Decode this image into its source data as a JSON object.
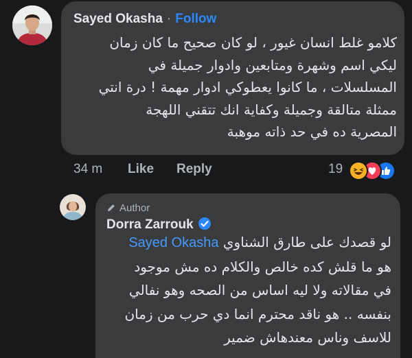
{
  "comment": {
    "author": "Sayed Okasha",
    "follow_label": "Follow",
    "separator": "·",
    "lines": [
      "كلامو غلط انسان غيور ، لو كان صحيح ما كان زمان",
      "ليكي اسم وشهرة ومتابعين وادوار جميلة في",
      "المسلسلات ، ما كانوا يعطوكي ادوار مهمة ! درة انتي",
      "ممثلة متالقة وجميلة وكفاية انك تتقني اللهجة",
      "المصرية ده في حد ذاته موهبة"
    ],
    "time": "34 m",
    "like_label": "Like",
    "reply_label": "Reply",
    "reaction_count": "19",
    "reactions": [
      "haha-icon",
      "love-icon",
      "like-icon"
    ]
  },
  "reply": {
    "badge": "Author",
    "author": "Dorra Zarrouk",
    "verified": true,
    "mention": "Sayed Okasha",
    "first_line_text": "لو قصدك على طارق الشناوي",
    "lines": [
      "هو ما قلش كده خالص والكلام ده مش موجود",
      "في مقالاته ولا ليه اساس من الصحه وهو نفالي",
      "بنفسه .. هو ناقد محترم انما دي حرب من زمان",
      "للاسف وناس معندهاش ضمير"
    ]
  },
  "colors": {
    "background": "#18191a",
    "bubble": "#3a3b3c",
    "link": "#2d88ff",
    "text": "#e4e6eb",
    "muted": "#b0b3b8"
  }
}
